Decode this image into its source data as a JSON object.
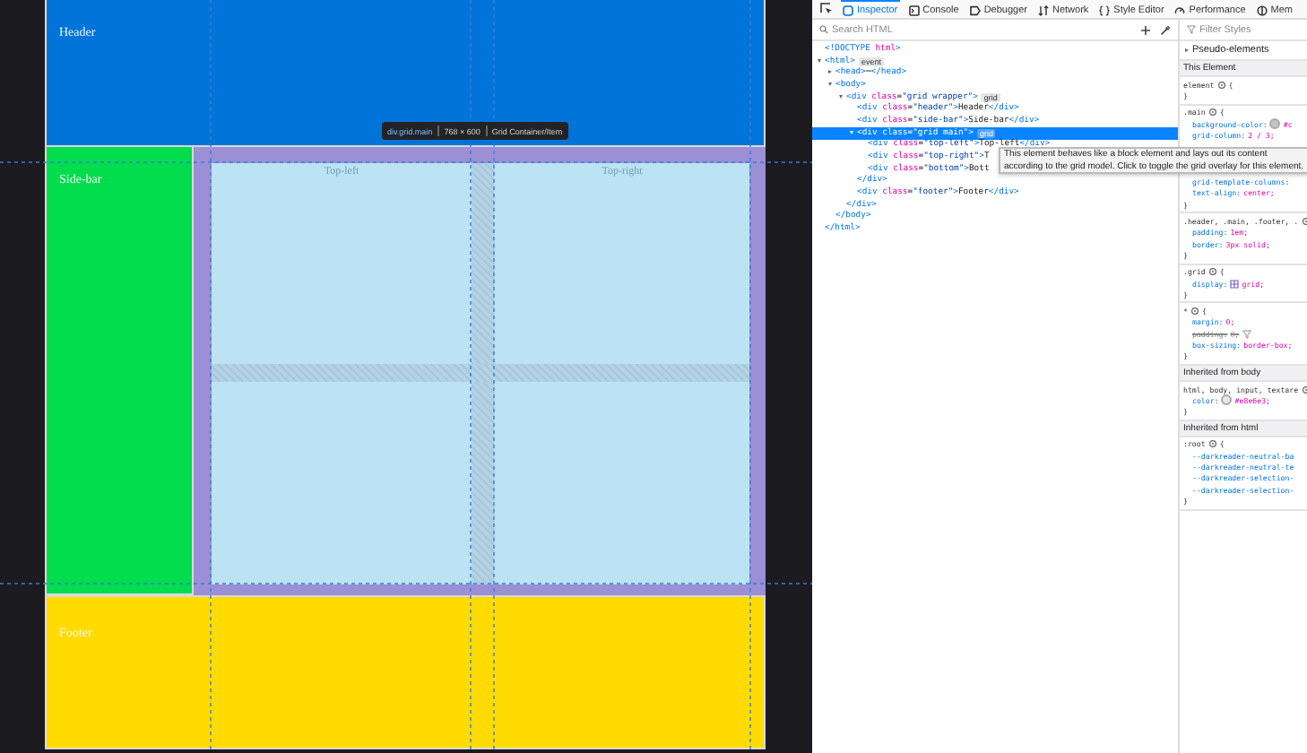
{
  "page": {
    "header": "Header",
    "sidebar": "Side-bar",
    "cells": [
      {
        "kind": "top-left",
        "text": "Top-left"
      },
      {
        "kind": "top-right",
        "text": "Top-right"
      },
      {
        "kind": "bottom"
      }
    ],
    "footer": "Footer",
    "grid_tooltip": {
      "element": "div.grid.main",
      "size": "768 × 600",
      "type": "Grid Container/Item"
    }
  },
  "devtools": {
    "tabs": [
      {
        "kind": "inspector",
        "label": "Inspector",
        "selected": true
      },
      {
        "kind": "console",
        "label": "Console",
        "selected": false
      },
      {
        "kind": "debugger",
        "label": "Debugger",
        "selected": false
      },
      {
        "kind": "network",
        "label": "Network",
        "selected": false
      },
      {
        "kind": "style",
        "label": "Style Editor",
        "selected": false
      },
      {
        "kind": "performance",
        "label": "Performance",
        "selected": false
      },
      {
        "kind": "memory",
        "label": "Mem",
        "selected": false
      }
    ],
    "search": {
      "placeholder": "Search HTML"
    },
    "tree": [
      {
        "text": "<!DOCTYPE html>",
        "selected": false
      },
      {
        "text": "<html>",
        "badge": "event",
        "expanded": true,
        "selected": false,
        "close": "</html>",
        "children": [
          {
            "text": "<head>⋯</head>",
            "expanded": false,
            "selected": false
          },
          {
            "text": "<body>",
            "expanded": true,
            "selected": false,
            "close": "</body>",
            "children": [
              {
                "text": "<div class=\"grid wrapper\">",
                "badge": "grid",
                "expanded": true,
                "selected": false,
                "close": "</div>",
                "children": [
                  {
                    "text": "<div class=\"header\">Header</div>",
                    "selected": false
                  },
                  {
                    "text": "<div class=\"side-bar\">Side-bar</div>",
                    "selected": false
                  },
                  {
                    "text": "<div class=\"grid main\">",
                    "badge": "grid",
                    "expanded": true,
                    "selected": true,
                    "close": "</div>",
                    "children": [
                      {
                        "text": "<div class=\"top-left\">Top-left</div>",
                        "selected": false
                      },
                      {
                        "text": "<div class=\"top-right\">T",
                        "selected": false
                      },
                      {
                        "text": "<div class=\"bottom\">Bott",
                        "selected": false
                      }
                    ]
                  },
                  {
                    "text": "<div class=\"footer\">Footer</div>",
                    "selected": false
                  }
                ]
              }
            ]
          }
        ]
      }
    ],
    "tooltip": "This element behaves like a block element and lays out its content according to the grid model. Click to toggle the grid overlay for this element.",
    "styles": {
      "filter_placeholder": "Filter Styles",
      "blocks": [
        {
          "kind": "collapsible",
          "text": "Pseudo-elements"
        },
        {
          "kind": "header",
          "text": "This Element"
        },
        {
          "kind": "rule",
          "selector": "element",
          "open": "{",
          "close": "}"
        },
        {
          "kind": "rule",
          "selector": ".main",
          "open": "{",
          "close": "}",
          "declarations": [
            {
              "prop": "background-color:",
              "value": "#c",
              "color": "#c4c4c4"
            },
            {
              "prop": "grid-column:",
              "value": "2 / 3;"
            },
            {
              "prop": "grid-template-columns:"
            },
            {
              "prop": "text-align:",
              "value": "center;"
            }
          ]
        },
        {
          "kind": "rule",
          "selector": ".header, .main, .footer, .",
          "close": "}",
          "declarations": [
            {
              "prop": "padding:",
              "value": "1em;"
            },
            {
              "prop": "border:",
              "value": "3px solid;"
            }
          ]
        },
        {
          "kind": "rule",
          "selector": ".grid",
          "open": "{",
          "close": "}",
          "declarations": [
            {
              "prop": "display:",
              "value": "grid;",
              "grid_icon": true
            }
          ]
        },
        {
          "kind": "rule",
          "selector": "*",
          "open": "{",
          "close": "}",
          "declarations": [
            {
              "prop": "margin:",
              "value": "0;"
            },
            {
              "prop": "padding:",
              "value": "0;",
              "overridden": true
            },
            {
              "prop": "box-sizing:",
              "value": "border-box;"
            }
          ]
        },
        {
          "kind": "header",
          "text": "Inherited from body"
        },
        {
          "kind": "rule",
          "selector": "html, body, input, textare",
          "close": "}",
          "declarations": [
            {
              "prop": "color:",
              "value": "#e8e6e3;",
              "color": "#e8e6e3"
            }
          ]
        },
        {
          "kind": "header",
          "text": "Inherited from html"
        },
        {
          "kind": "rule",
          "selector": ":root",
          "open": "{",
          "close": "}",
          "declarations": [
            {
              "prop": "--darkreader-neutral-ba"
            },
            {
              "prop": "--darkreader-neutral-te"
            },
            {
              "prop": "--darkreader-selection-"
            },
            {
              "prop": "--darkreader-selection-"
            }
          ]
        }
      ]
    }
  }
}
